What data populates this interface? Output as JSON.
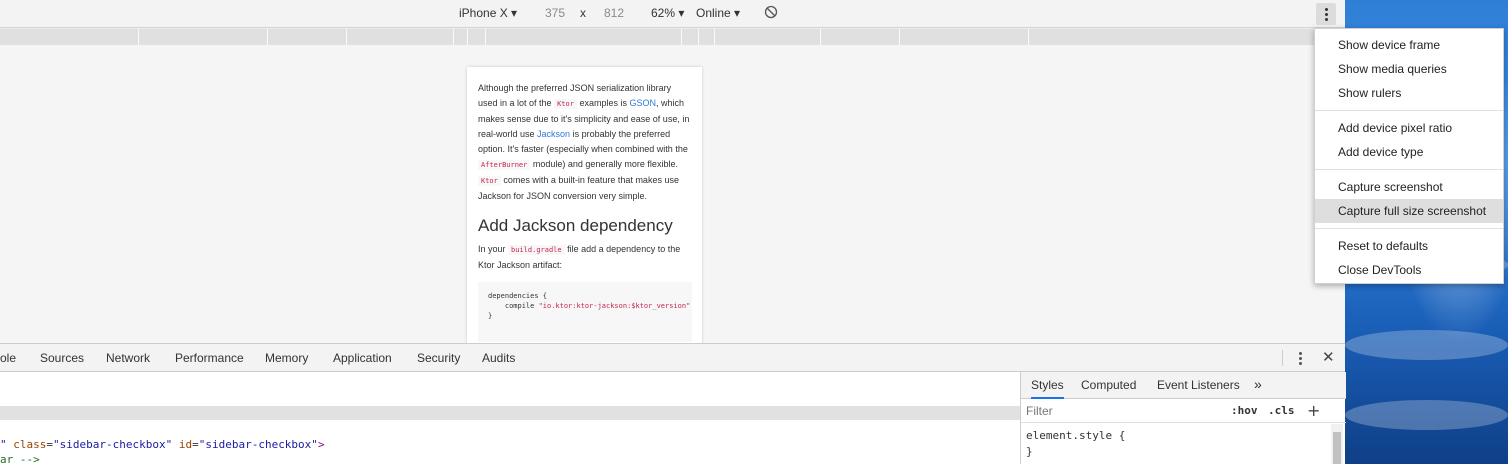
{
  "device_toolbar": {
    "device": "iPhone X",
    "width": "375",
    "times": "x",
    "height": "812",
    "zoom": "62%",
    "network": "Online"
  },
  "page": {
    "para1": {
      "t1": "Although the preferred JSON serialization library used in a lot of the",
      "code1": "Ktor",
      "t2": "examples is",
      "link1": "GSON",
      "t3": ", which makes sense due to it's simplicity and ease of use, in real-world use",
      "link2": "Jackson",
      "t4": "is probably the preferred option. It's faster (especially when combined with the",
      "code2": "AfterBurner",
      "t5": "module) and generally more flexible.",
      "code3": "Ktor",
      "t6": "comes with a built-in feature that makes use Jackson for JSON conversion very simple."
    },
    "heading": "Add Jackson dependency",
    "para2": {
      "t1": "In your",
      "code1": "build.gradle",
      "t2": "file add a dependency to the Ktor Jackson artifact:"
    },
    "code_block": {
      "line1": "dependencies {",
      "line2_prefix": "    compile ",
      "line2_str": "\"io.ktor:ktor-jackson:$ktor_version\"",
      "line3": "}"
    }
  },
  "menu": {
    "items": [
      "Show device frame",
      "Show media queries",
      "Show rulers",
      "Add device pixel ratio",
      "Add device type",
      "Capture screenshot",
      "Capture full size screenshot",
      "Reset to defaults",
      "Close DevTools"
    ]
  },
  "devtools": {
    "tabs": [
      "ole",
      "Sources",
      "Network",
      "Performance",
      "Memory",
      "Application",
      "Security",
      "Audits"
    ],
    "code_lines": {
      "line1_q": "\"",
      "line1_attr1": "class",
      "line1_val1": "\"sidebar-checkbox\"",
      "line1_attr2": "id",
      "line1_val2": "\"sidebar-checkbox\"",
      "line1_end": ">",
      "line2": "ar -->"
    }
  },
  "styles": {
    "tabs": [
      "Styles",
      "Computed",
      "Event Listeners",
      "»"
    ],
    "filter_placeholder": "Filter",
    "hov": ":hov",
    "cls": ".cls",
    "add": "+",
    "element_style_open": "element.style {",
    "element_style_close": "}"
  }
}
